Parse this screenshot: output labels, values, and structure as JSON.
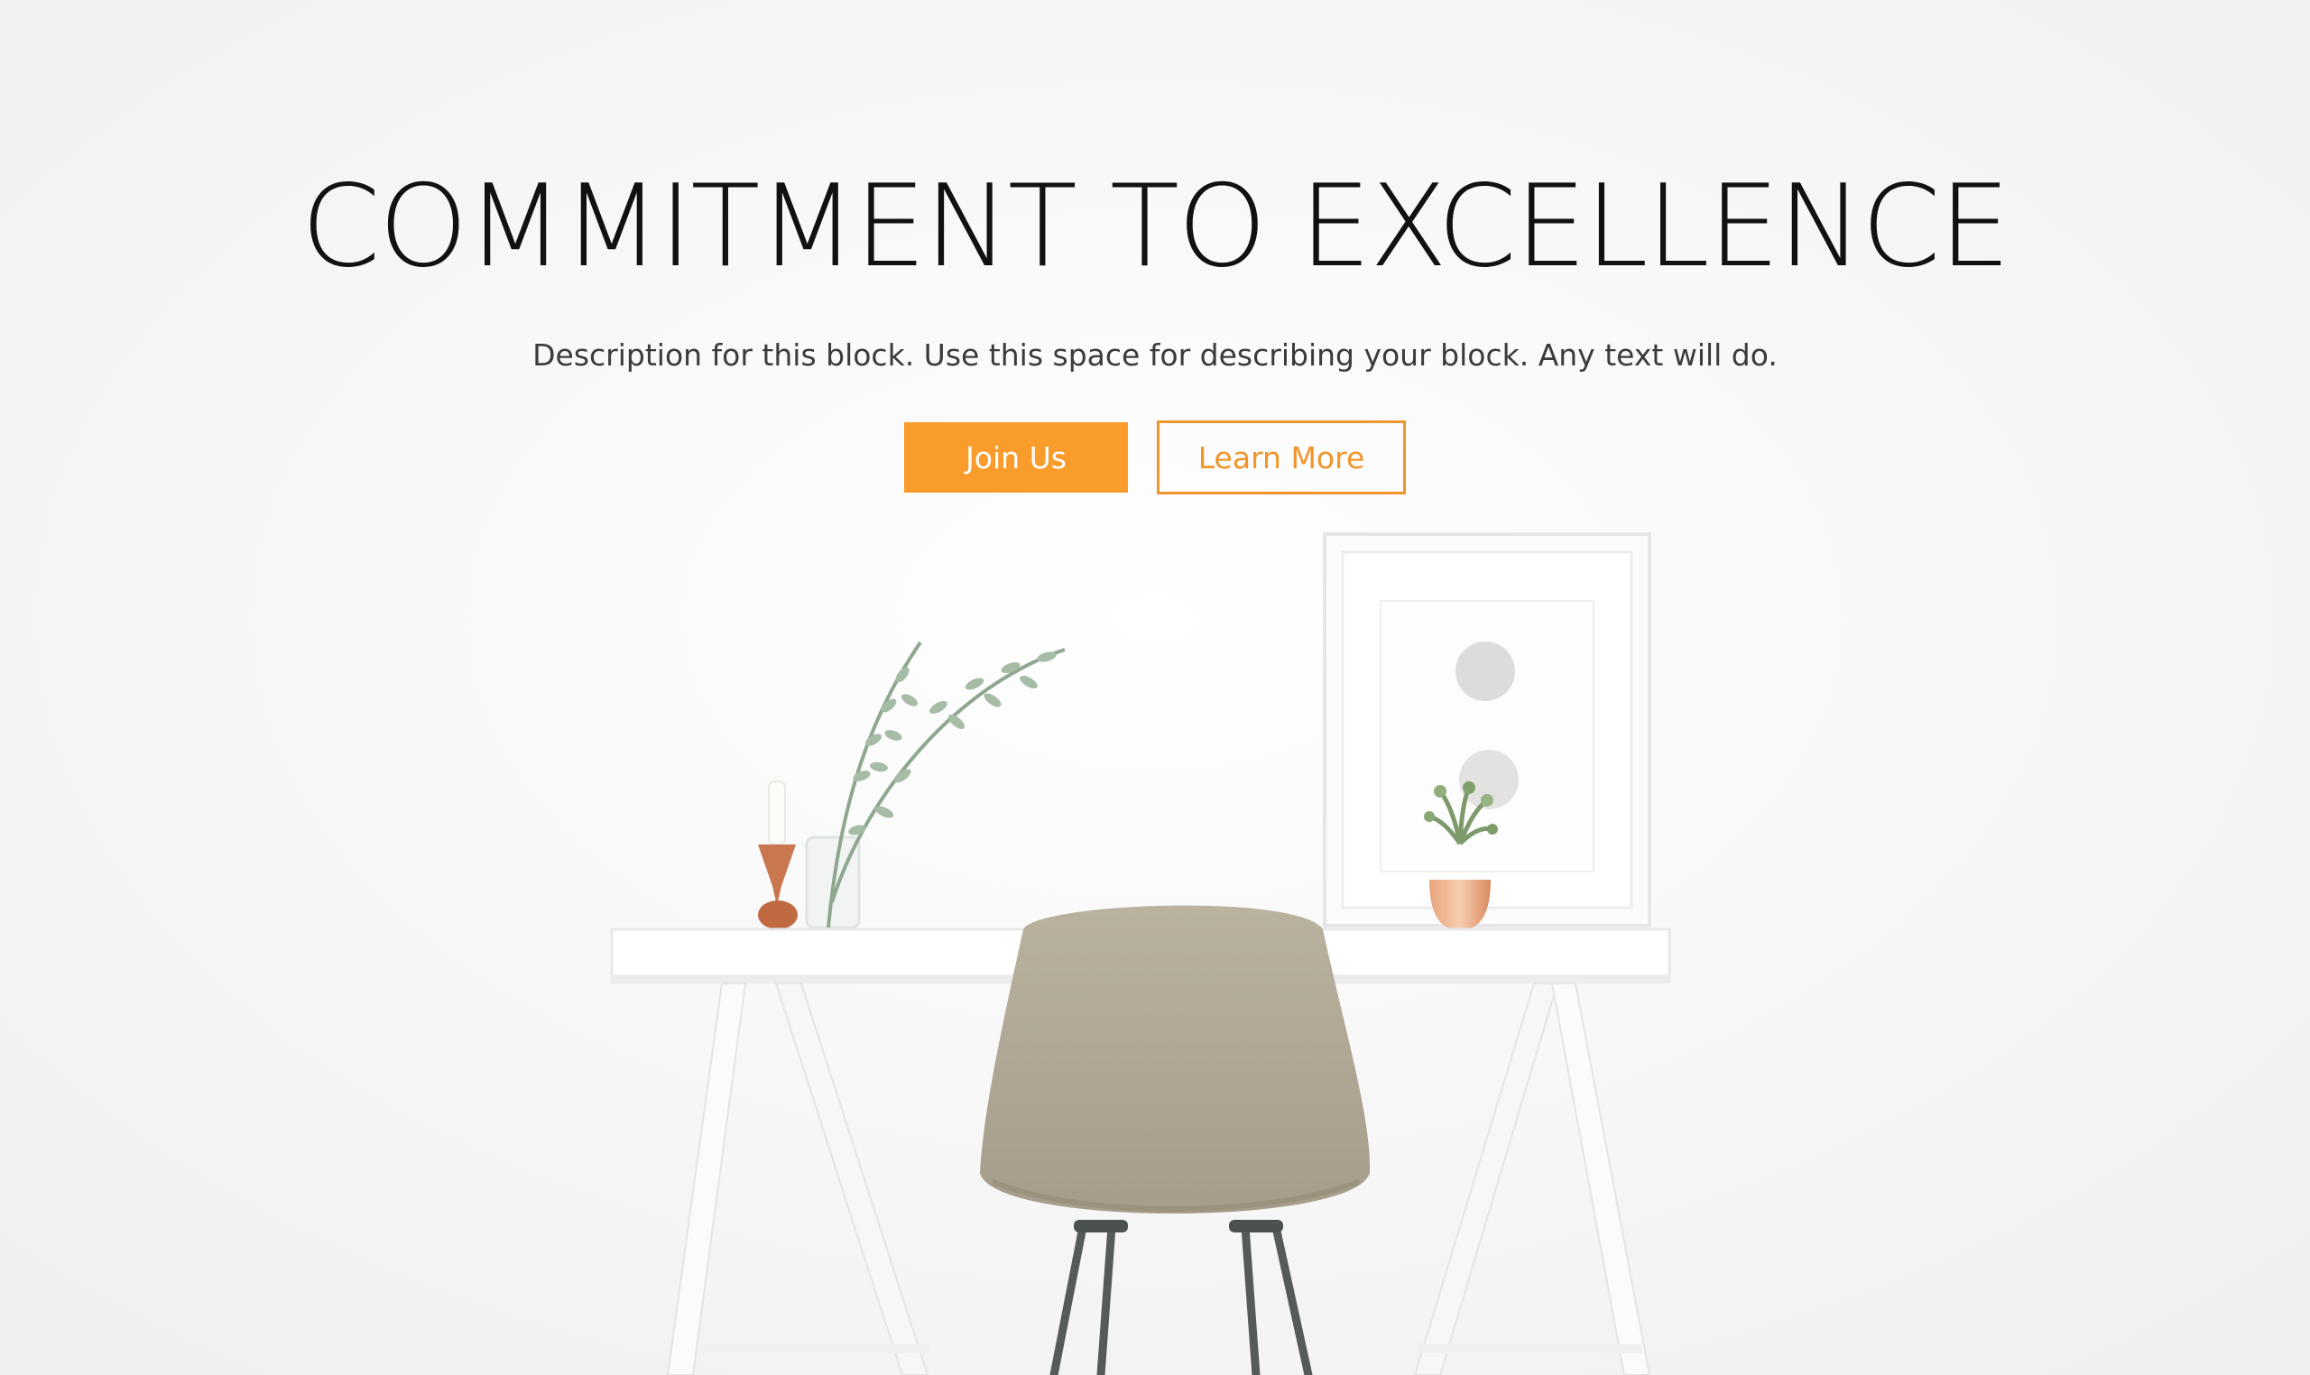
{
  "hero": {
    "title": "COMMITMENT TO EXCELLENCE",
    "description": "Description for this block. Use this space for describing your block. Any text will do.",
    "primary_button_label": "Join Us",
    "secondary_button_label": "Learn More"
  },
  "colors": {
    "accent": "#fa9c2b",
    "heading": "#111111",
    "body_text": "#3b3b3b",
    "background": "#f7f7f8"
  }
}
